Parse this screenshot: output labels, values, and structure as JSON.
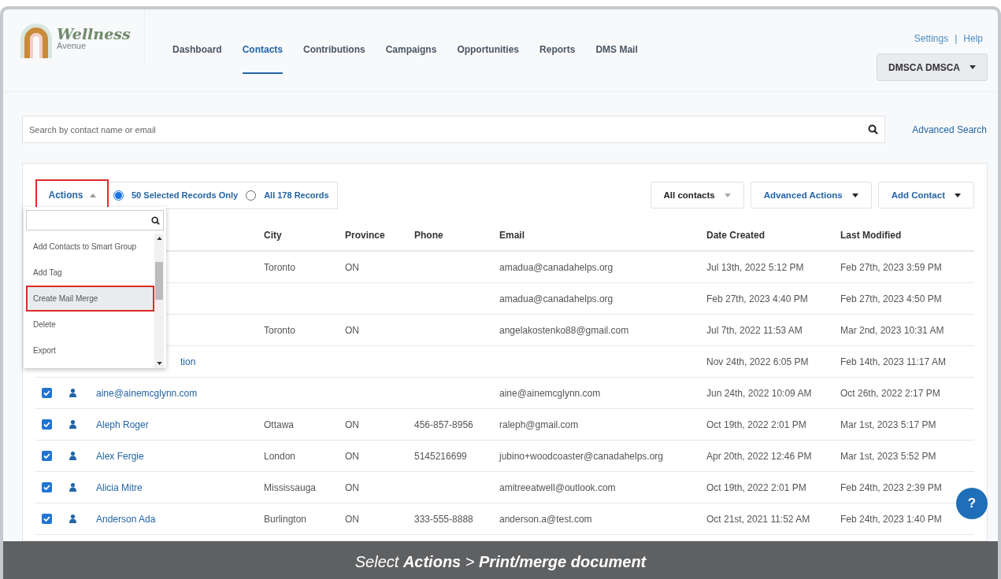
{
  "logo": {
    "title": "Wellness",
    "subtitle": "Avenue"
  },
  "nav": [
    {
      "label": "Dashboard",
      "selected": false
    },
    {
      "label": "Contacts",
      "selected": true
    },
    {
      "label": "Contributions",
      "selected": false
    },
    {
      "label": "Campaigns",
      "selected": false
    },
    {
      "label": "Opportunities",
      "selected": false
    },
    {
      "label": "Reports",
      "selected": false
    },
    {
      "label": "DMS Mail",
      "selected": false
    }
  ],
  "top_links": [
    "Settings",
    "|",
    "Help"
  ],
  "user_menu": "DMSCA DMSCA",
  "search": {
    "placeholder": "Search by contact name or email"
  },
  "advanced_search": "Advanced Search",
  "actions": {
    "label": "Actions",
    "outlined": true,
    "expanded": true
  },
  "scope": [
    {
      "label": "50 Selected Records Only",
      "selected": true
    },
    {
      "label": "All 178 Records",
      "selected": false
    }
  ],
  "filter": "All contacts",
  "advanced_actions": "Advanced Actions",
  "add_contact": "Add Contact",
  "actions_menu": [
    {
      "label": "Add Contacts to Smart Group",
      "highlighted": false,
      "outlined": false
    },
    {
      "label": "Add Tag",
      "highlighted": false,
      "outlined": false
    },
    {
      "label": "Create Mail Merge",
      "highlighted": true,
      "outlined": true
    },
    {
      "label": "Delete",
      "highlighted": false,
      "outlined": false
    },
    {
      "label": "Export",
      "highlighted": false,
      "outlined": false
    }
  ],
  "table": {
    "columns": [
      "City",
      "Province",
      "Phone",
      "Email",
      "Date Created",
      "Last Modified"
    ],
    "rows": [
      {
        "city": "Toronto",
        "province": "ON",
        "phone": "",
        "email": "amadua@canadahelps.org",
        "created": "Jul 13th, 2022 5:12 PM",
        "modified": "Feb 27th, 2023 3:59 PM"
      },
      {
        "city": "",
        "province": "",
        "phone": "",
        "email": "amadua@canadahelps.org",
        "created": "Feb 27th, 2023 4:40 PM",
        "modified": "Feb 27th, 2023 4:50 PM"
      },
      {
        "city": "Toronto",
        "province": "ON",
        "phone": "",
        "email": "angelakostenko88@gmail.com",
        "created": "Jul 7th, 2022 11:53 AM",
        "modified": "Mar 2nd, 2023 10:31 AM"
      },
      {
        "name": "tion",
        "city": "",
        "province": "",
        "phone": "",
        "email": "",
        "created": "Nov 24th, 2022 6:05 PM",
        "modified": "Feb 14th, 2023 11:17 AM"
      },
      {
        "checked": true,
        "name": "aine@ainemcglynn.com",
        "city": "",
        "province": "",
        "phone": "",
        "email": "aine@ainemcglynn.com",
        "created": "Jun 24th, 2022 10:09 AM",
        "modified": "Oct 26th, 2022 2:17 PM"
      },
      {
        "checked": true,
        "name": "Aleph Roger",
        "city": "Ottawa",
        "province": "ON",
        "phone": "456-857-8956",
        "email": "raleph@gmail.com",
        "created": "Oct 19th, 2022 2:01 PM",
        "modified": "Mar 1st, 2023 5:17 PM"
      },
      {
        "checked": true,
        "name": "Alex Fergie",
        "city": "London",
        "province": "ON",
        "phone": "5145216699",
        "email": "jubino+woodcoaster@canadahelps.org",
        "created": "Apr 20th, 2022 12:46 PM",
        "modified": "Mar 1st, 2023 5:52 PM"
      },
      {
        "checked": true,
        "name": "Alicia Mitre",
        "city": "Mississauga",
        "province": "ON",
        "phone": "",
        "email": "amitreeatwell@outlook.com",
        "created": "Oct 19th, 2022 2:01 PM",
        "modified": "Feb 24th, 2023 2:39 PM"
      },
      {
        "checked": true,
        "name": "Anderson Ada",
        "city": "Burlington",
        "province": "ON",
        "phone": "333-555-8888",
        "email": "anderson.a@test.com",
        "created": "Oct 21st, 2021 11:52 AM",
        "modified": "Feb 24th, 2023 1:40 PM"
      }
    ]
  },
  "help_button": "?",
  "caption": "Select **Actions** > **Print/merge document**"
}
